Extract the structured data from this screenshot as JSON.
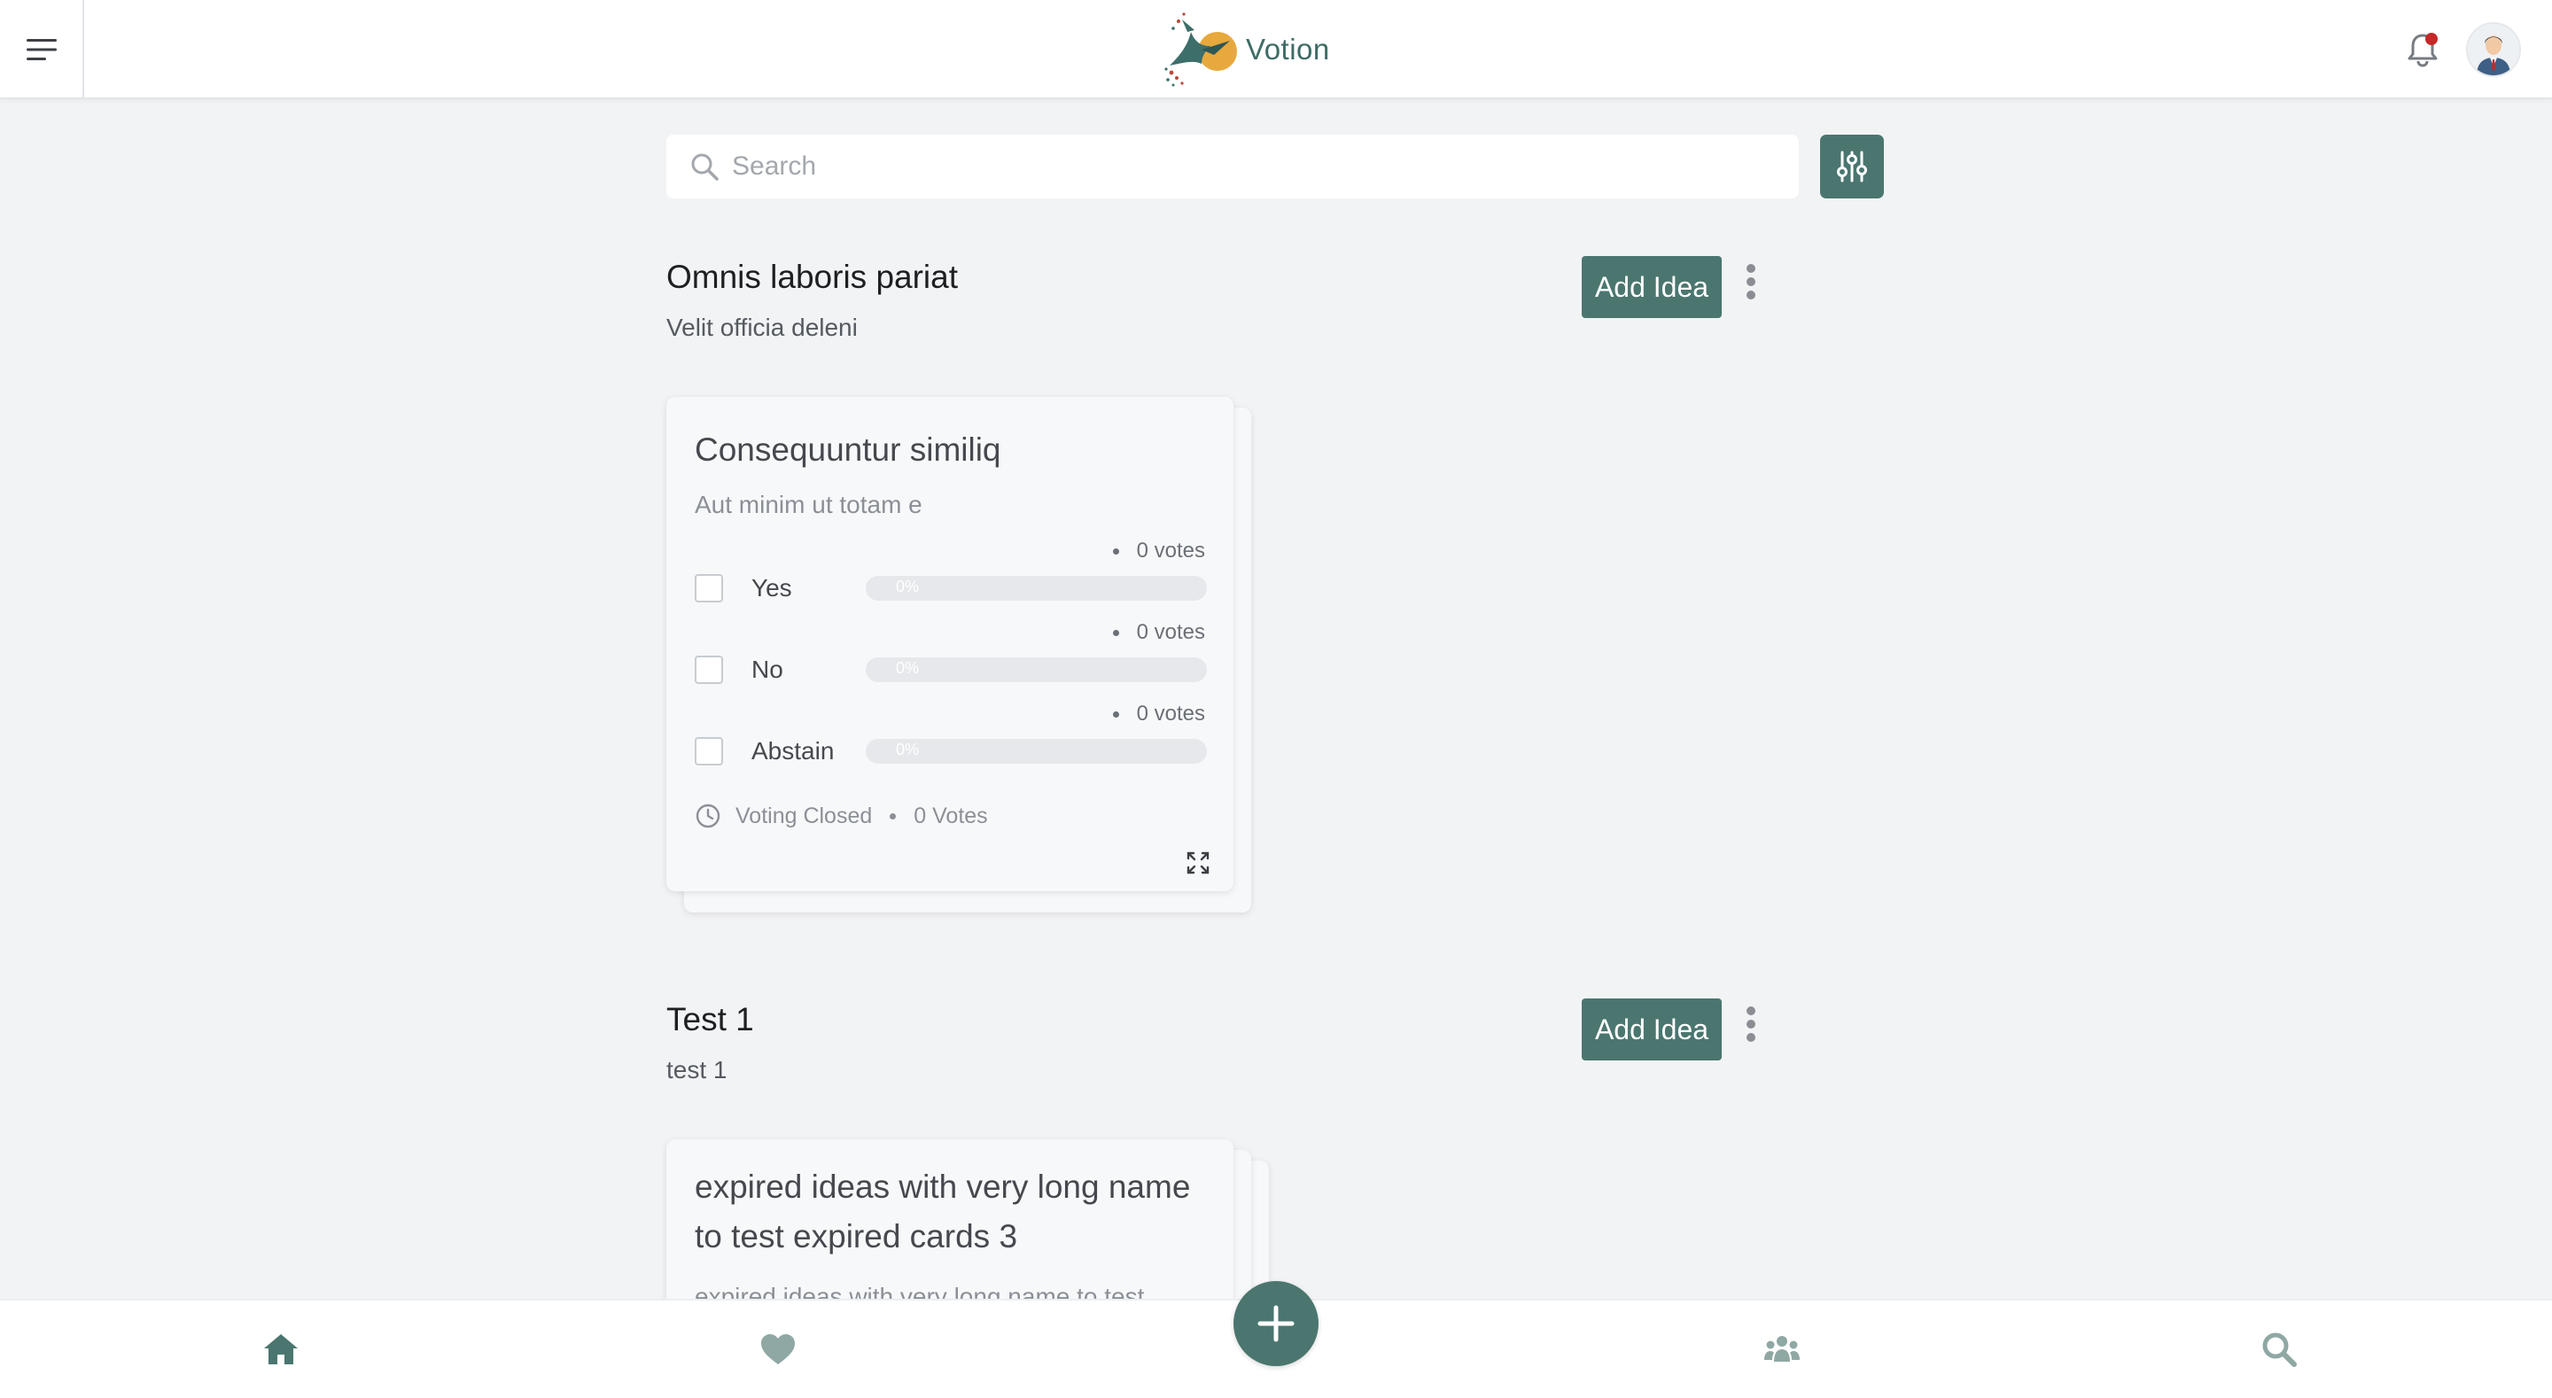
{
  "app": {
    "name": "Votion"
  },
  "search": {
    "placeholder": "Search",
    "value": ""
  },
  "sections": [
    {
      "title": "Omnis laboris pariat",
      "subtitle": "Velit officia deleni",
      "add_label": "Add Idea",
      "card": {
        "title": "Consequuntur similiq",
        "description": "Aut minim ut totam e",
        "options": [
          {
            "label": "Yes",
            "votes": "0 votes",
            "percent": "0%",
            "fraction": 0
          },
          {
            "label": "No",
            "votes": "0 votes",
            "percent": "0%",
            "fraction": 0
          },
          {
            "label": "Abstain",
            "votes": "0 votes",
            "percent": "0%",
            "fraction": 0
          }
        ],
        "status": "Voting Closed",
        "total_votes": "0 Votes"
      }
    },
    {
      "title": "Test 1",
      "subtitle": "test 1",
      "add_label": "Add Idea",
      "card": {
        "title_line1": "expired ideas with very long name",
        "title_line2": "to test expired cards 3",
        "description": "expired ideas with very long name to test"
      }
    }
  ],
  "colors": {
    "accent": "#4a766f",
    "background": "#f2f3f5",
    "notification": "#c62828"
  },
  "icons": {
    "menu": "menu-icon",
    "bell": "bell-icon",
    "filter": "sliders-icon",
    "home": "home-icon",
    "heart": "heart-icon",
    "add": "plus-icon",
    "groups": "users-icon",
    "search": "search-icon"
  }
}
